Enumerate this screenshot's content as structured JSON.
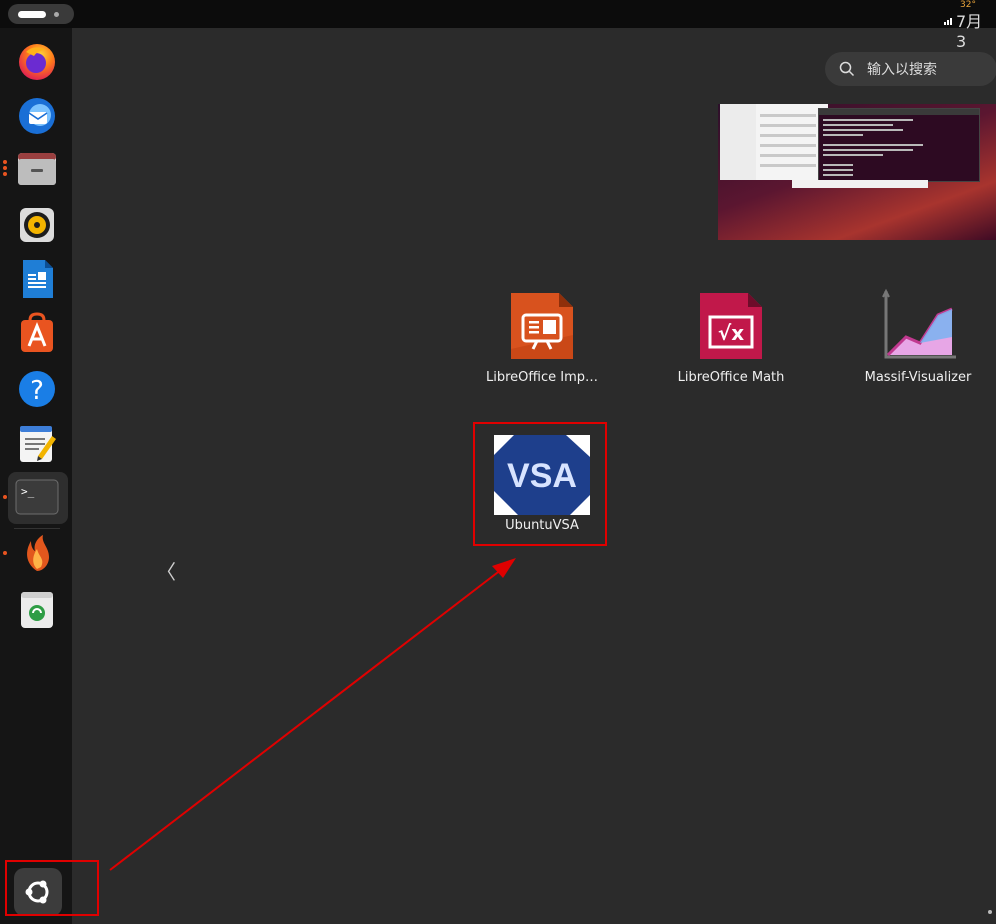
{
  "topbar": {
    "clock_text": "7月3",
    "temperature_text": "32°"
  },
  "search": {
    "placeholder": "输入以搜索"
  },
  "dock": {
    "items": [
      {
        "name": "Firefox",
        "icon": "firefox-icon"
      },
      {
        "name": "Thunderbird",
        "icon": "thunderbird-icon"
      },
      {
        "name": "Files",
        "icon": "files-icon"
      },
      {
        "name": "Rhythmbox",
        "icon": "rhythmbox-icon"
      },
      {
        "name": "LibreOffice Writer",
        "icon": "writer-icon"
      },
      {
        "name": "Ubuntu Software",
        "icon": "software-icon"
      },
      {
        "name": "Help",
        "icon": "help-icon"
      },
      {
        "name": "Text Editor",
        "icon": "text-editor-icon"
      },
      {
        "name": "Terminal",
        "icon": "terminal-icon"
      },
      {
        "name": "App",
        "icon": "flame-icon"
      },
      {
        "name": "Trash",
        "icon": "trash-icon"
      }
    ],
    "help_glyph": "?",
    "terminal_glyph": ">_"
  },
  "apps": [
    {
      "label": "LibreOffice Imp…",
      "icon": "libreoffice-impress-icon"
    },
    {
      "label": "LibreOffice Math",
      "icon": "libreoffice-math-icon"
    },
    {
      "label": "Massif-Visualizer",
      "icon": "massif-visualizer-icon"
    },
    {
      "label": "UbuntuVSA",
      "icon": "ubuntuvsa-icon",
      "icon_text": "VSA"
    }
  ],
  "math_glyph": "√x",
  "prev_glyph": "〈",
  "colors": {
    "accent": "#e95420",
    "highlight": "#e00000",
    "background": "#2b2b2b",
    "dock": "#151515"
  }
}
